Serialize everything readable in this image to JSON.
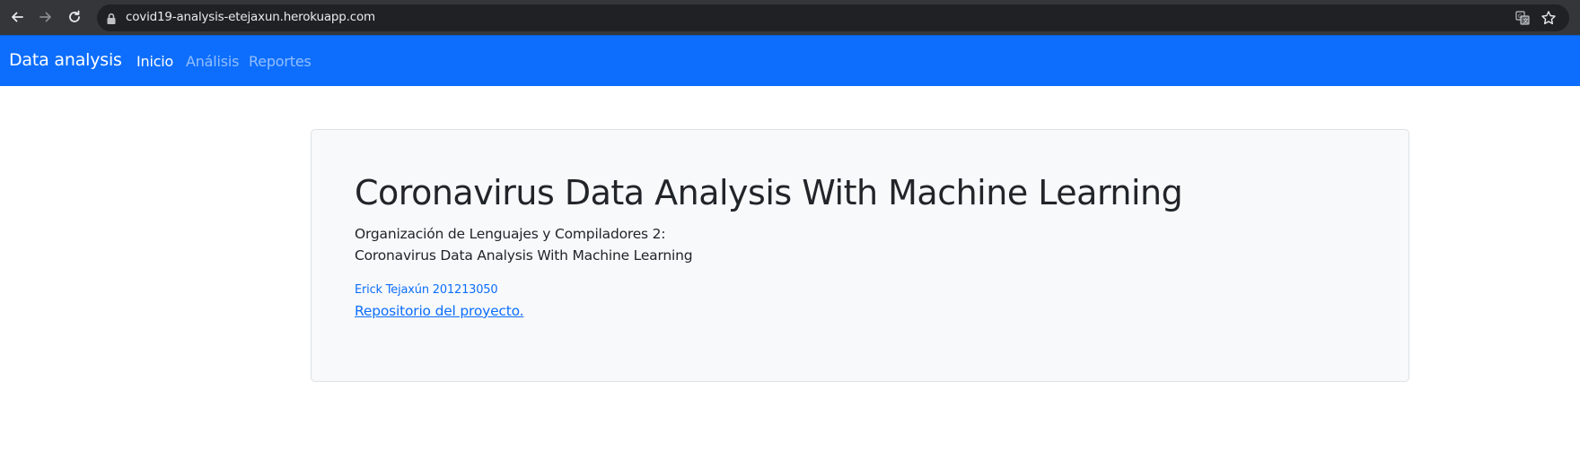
{
  "browser": {
    "url": "covid19-analysis-etejaxun.herokuapp.com",
    "icons": [
      "back-arrow-icon",
      "forward-arrow-icon",
      "reload-icon",
      "lock-icon",
      "translate-icon",
      "star-icon"
    ]
  },
  "navbar": {
    "brand": "Data analysis",
    "links": [
      {
        "label": "Inicio",
        "active": true
      },
      {
        "label": "Análisis",
        "active": false
      },
      {
        "label": "Reportes",
        "active": false
      }
    ],
    "color": "#0d6efd"
  },
  "jumbotron": {
    "title": "Coronavirus Data Analysis With Machine Learning",
    "subtitle_line1": "Organización de Lenguajes y Compiladores 2:",
    "subtitle_line2": "Coronavirus Data Analysis With Machine Learning",
    "author": "Erick Tejaxún 201213050",
    "repo_link": "Repositorio del proyecto."
  }
}
